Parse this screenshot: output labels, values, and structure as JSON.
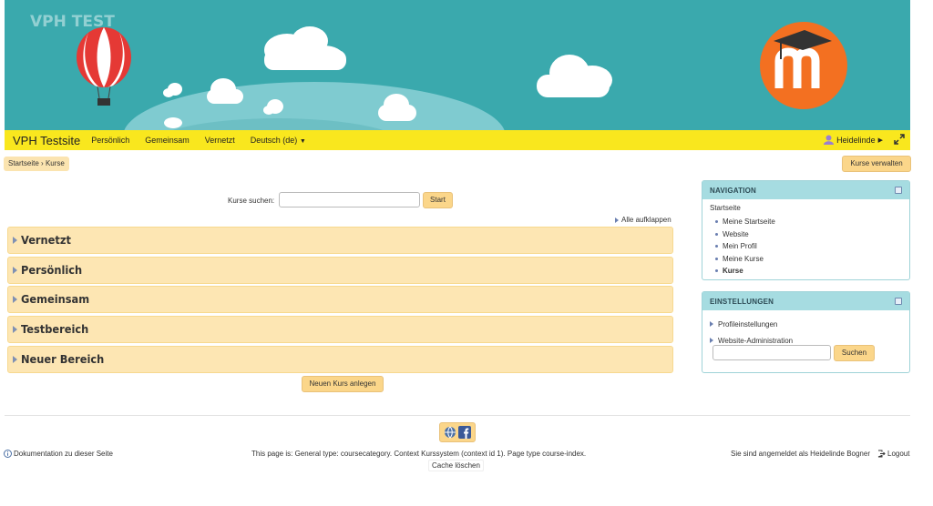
{
  "banner": {
    "watermark": "VPH TEST"
  },
  "navbar": {
    "brand": "VPH Testsite",
    "links": [
      "Persönlich",
      "Gemeinsam",
      "Vernetzt"
    ],
    "language": "Deutsch (de)",
    "user": "Heidelinde"
  },
  "breadcrumb": {
    "home": "Startseite",
    "separator": "›",
    "current": "Kurse"
  },
  "manage_button": "Kurse verwalten",
  "search": {
    "label": "Kurse suchen:",
    "value": "",
    "button": "Start"
  },
  "expand_all": "Alle aufklappen",
  "categories": [
    "Vernetzt",
    "Persönlich",
    "Gemeinsam",
    "Testbereich",
    "Neuer Bereich"
  ],
  "new_course_button": "Neuen Kurs anlegen",
  "navigation_block": {
    "title": "NAVIGATION",
    "root": "Startseite",
    "items": [
      "Meine Startseite",
      "Website",
      "Mein Profil",
      "Meine Kurse",
      "Kurse"
    ]
  },
  "settings_block": {
    "title": "EINSTELLUNGEN",
    "items": [
      "Profileinstellungen",
      "Website-Administration"
    ],
    "search_value": "",
    "search_button": "Suchen"
  },
  "footer": {
    "doc_link": "Dokumentation zu dieser Seite",
    "page_info": "This page is: General type: coursecategory. Context Kurssystem (context id 1). Page type course-index.",
    "cache": "Cache löschen",
    "logged_in": "Sie sind angemeldet als Heidelinde Bogner",
    "logout": "Logout"
  },
  "colors": {
    "banner_bg": "#3aa9ad",
    "navbar_bg": "#f9e71e",
    "category_bg": "#fde6b3",
    "button_bg": "#fbd68a",
    "block_header": "#a6dce1"
  },
  "icons": [
    "hot-air-balloon-icon",
    "moodle-logo-icon",
    "user-icon",
    "expand-screen-icon",
    "globe-icon",
    "facebook-icon",
    "info-icon",
    "logout-icon"
  ]
}
